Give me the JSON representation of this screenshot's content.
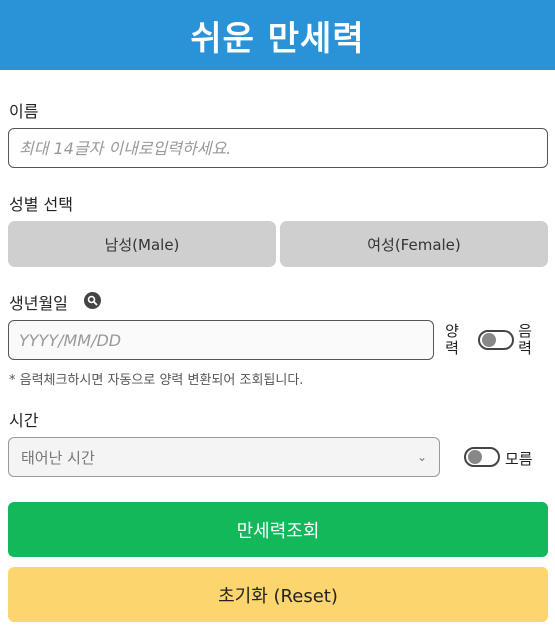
{
  "header": {
    "title": "쉬운 만세력"
  },
  "name": {
    "label": "이름",
    "placeholder": "최대 14글자 이내로입력하세요."
  },
  "gender": {
    "label": "성별 선택",
    "male_label": "남성(Male)",
    "female_label": "여성(Female)"
  },
  "birth": {
    "label": "생년월일",
    "placeholder": "YYYY/MM/DD",
    "solar_label": [
      "양",
      "력"
    ],
    "lunar_label": [
      "음",
      "력"
    ],
    "lunar_toggle_on": false,
    "note": "* 음력체크하시면 자동으로 양력 변환되어 조회됩니다."
  },
  "time": {
    "label": "시간",
    "selected": "태어난 시간",
    "unknown_label": "모름",
    "unknown_toggle_on": false
  },
  "actions": {
    "search_label": "만세력조회",
    "reset_label": "초기화 (Reset)"
  },
  "colors": {
    "header": "#2a93d8",
    "search_button": "#12b85a",
    "reset_button": "#fdd56f",
    "gender_button": "#cfcfcf"
  }
}
